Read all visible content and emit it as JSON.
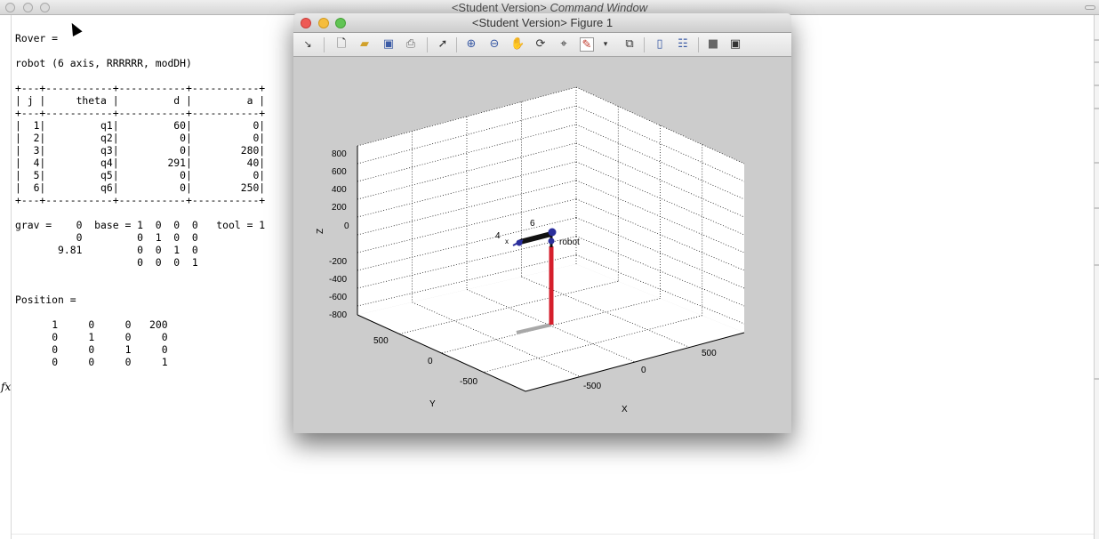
{
  "command_window": {
    "title_prefix": "<Student Version>",
    "title_suffix": "Command Window"
  },
  "output": {
    "rover_line": "Rover = ",
    "robot_line": "robot (6 axis, RRRRRR, modDH)",
    "dh_table": "+---+-----------+-----------+-----------+\n| j |     theta |         d |         a |\n+---+-----------+-----------+-----------+\n|  1|         q1|         60|          0|\n|  2|         q2|          0|          0|\n|  3|         q3|          0|        280|\n|  4|         q4|        291|         40|\n|  5|         q5|          0|          0|\n|  6|         q6|          0|        250|\n+---+-----------+-----------+-----------+",
    "grav_base_tool": "grav =    0  base = 1  0  0  0   tool = 1\n          0         0  1  0  0\n       9.81         0  0  1  0\n                    0  0  0  1",
    "position_label": "Position =",
    "position_matrix": "     1     0     0   200\n     0     1     0     0\n     0     0     1     0\n     0     0     0     1",
    "fx_symbol": "fx"
  },
  "figure": {
    "title": "<Student Version> Figure 1",
    "toolbar": [
      "dock-arrow",
      "new-figure",
      "open-file",
      "save",
      "print",
      "pointer",
      "zoom-in",
      "zoom-out",
      "pan",
      "rotate-3d",
      "data-cursor",
      "brush",
      "link-plot",
      "colorbar",
      "legend",
      "hide-plot-tools",
      "show-plot-tools"
    ]
  },
  "plot": {
    "z_axis_label": "Z",
    "y_axis_label": "Y",
    "x_axis_label": "X",
    "z_ticks": [
      "800",
      "600",
      "400",
      "200",
      "0",
      "-200",
      "-400",
      "-600",
      "-800"
    ],
    "y_ticks": [
      "500",
      "0",
      "-500"
    ],
    "x_ticks": [
      "-500",
      "0",
      "500"
    ],
    "robot_label": "robot",
    "joint_label_6": "6",
    "joint_label_4": "4",
    "joint_label_x": "x",
    "colors": {
      "link": "#d51f2c",
      "shadow": "#a8a8a8",
      "joint": "#2b2f9c",
      "arm": "#111111"
    }
  }
}
